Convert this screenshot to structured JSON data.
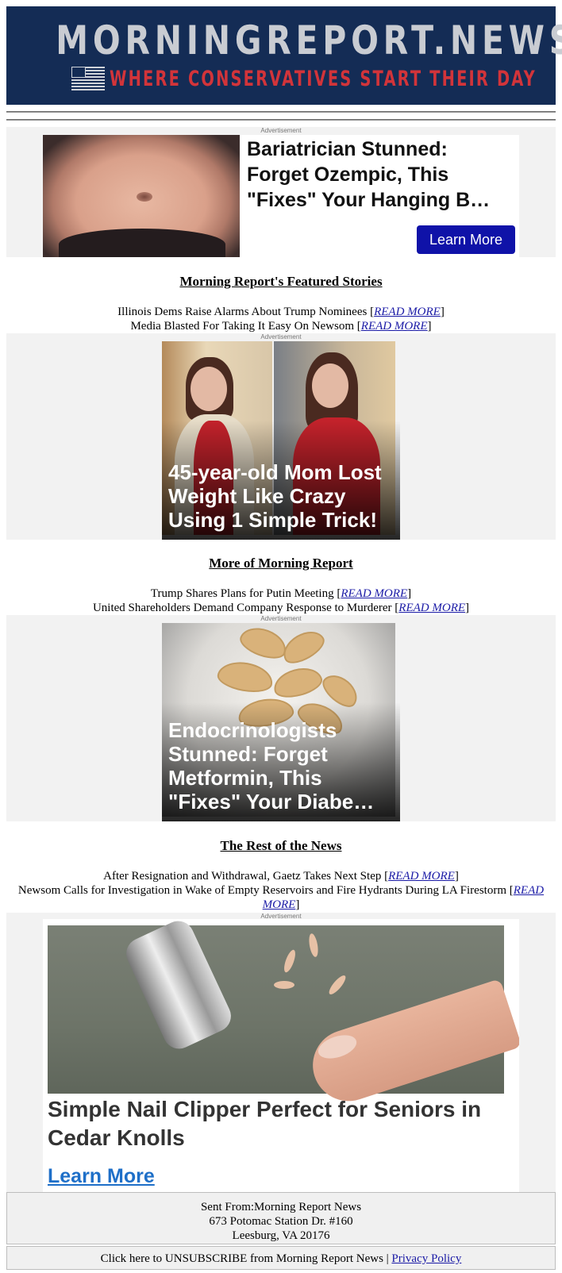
{
  "header": {
    "brand": "MORNINGREPORT.NEWS",
    "tagline": "WHERE CONSERVATIVES START THEIR DAY"
  },
  "ad_label": "Advertisement",
  "ad1": {
    "headline": "Bariatrician Stunned: Forget Ozempic, This \"Fixes\" Your Hanging B…",
    "button": "Learn More"
  },
  "sections": [
    {
      "title": "Morning Report's Featured Stories",
      "stories": [
        {
          "text": "Illinois Dems Raise Alarms About Trump Nominees",
          "link": "READ MORE"
        },
        {
          "text": "Media Blasted For Taking It Easy On Newsom",
          "link": "READ MORE"
        }
      ]
    },
    {
      "title": "More of Morning Report",
      "stories": [
        {
          "text": "Trump Shares Plans for Putin Meeting",
          "link": "READ MORE"
        },
        {
          "text": "United Shareholders Demand Company Response to Murderer",
          "link": "READ MORE"
        }
      ]
    },
    {
      "title": "The Rest of the News",
      "stories": [
        {
          "text": "After Resignation and Withdrawal, Gaetz Takes Next Step",
          "link": "READ MORE"
        },
        {
          "text": "Newsom Calls for Investigation in Wake of Empty Reservoirs and Fire Hydrants During LA Firestorm",
          "link": "READ MORE"
        }
      ]
    }
  ],
  "ad2": {
    "caption": "45-year-old Mom Lost Weight Like Crazy Using 1 Simple Trick!"
  },
  "ad3": {
    "caption": "Endocrinologists Stunned: Forget Metformin, This \"Fixes\" Your Diabe…"
  },
  "ad4": {
    "headline": "Simple Nail Clipper Perfect for Seniors in Cedar Knolls",
    "button": "Learn More"
  },
  "footer": {
    "sent_from": "Sent From:Morning Report News",
    "address1": "673 Potomac Station Dr. #160",
    "address2": "Leesburg, VA 20176",
    "unsubscribe": "Click here to UNSUBSCRIBE from Morning Report News",
    "separator": "|",
    "privacy": "Privacy Policy"
  },
  "colors": {
    "header_bg": "#142c55",
    "brand": "#c9ccd2",
    "tagline": "#d2343a",
    "ad_button": "#0f12a8",
    "link": "#1a1aa6",
    "clipper_link": "#1e6fc8"
  }
}
